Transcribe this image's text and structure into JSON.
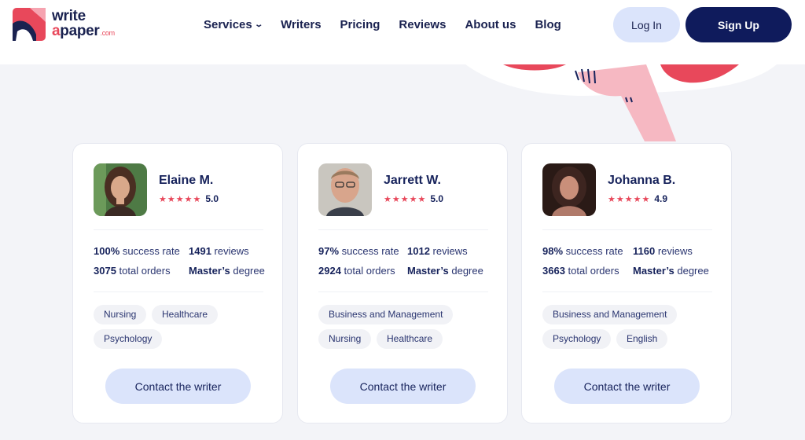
{
  "header": {
    "logo_line1": "write",
    "logo_a": "a",
    "logo_paper": "paper",
    "logo_com": ".com",
    "nav": {
      "services": "Services",
      "writers": "Writers",
      "pricing": "Pricing",
      "reviews": "Reviews",
      "about": "About us",
      "blog": "Blog"
    },
    "login_label": "Log In",
    "signup_label": "Sign Up"
  },
  "writers": [
    {
      "name": "Elaine M.",
      "stars": "★★★★★",
      "rating": "5.0",
      "success_value": "100%",
      "success_label": " success rate",
      "reviews_value": "1491",
      "reviews_label": " reviews",
      "orders_value": "3075",
      "orders_label": " total orders",
      "degree_value": "Master’s",
      "degree_label": " degree",
      "tags": [
        "Nursing",
        "Healthcare",
        "Psychology"
      ],
      "contact_label": "Contact the writer"
    },
    {
      "name": "Jarrett W.",
      "stars": "★★★★★",
      "rating": "5.0",
      "success_value": "97%",
      "success_label": " success rate",
      "reviews_value": "1012",
      "reviews_label": " reviews",
      "orders_value": "2924",
      "orders_label": " total orders",
      "degree_value": "Master’s",
      "degree_label": " degree",
      "tags": [
        "Business and Management",
        "Nursing",
        "Healthcare"
      ],
      "contact_label": "Contact the writer"
    },
    {
      "name": "Johanna B.",
      "stars": "★★★★★",
      "rating": "4.9",
      "success_value": "98%",
      "success_label": " success rate",
      "reviews_value": "1160",
      "reviews_label": " reviews",
      "orders_value": "3663",
      "orders_label": " total orders",
      "degree_value": "Master’s",
      "degree_label": " degree",
      "tags": [
        "Business and Management",
        "Psychology",
        "English"
      ],
      "contact_label": "Contact the writer"
    }
  ],
  "colors": {
    "brand_navy": "#0f1b5c",
    "accent_red": "#e8485b",
    "button_light": "#dbe4fb",
    "page_bg": "#f3f4f8"
  },
  "icons": {
    "logo": "writeapaper-logo-mark",
    "services_dropdown": "chevron-down-icon",
    "rating": "star-icon"
  }
}
